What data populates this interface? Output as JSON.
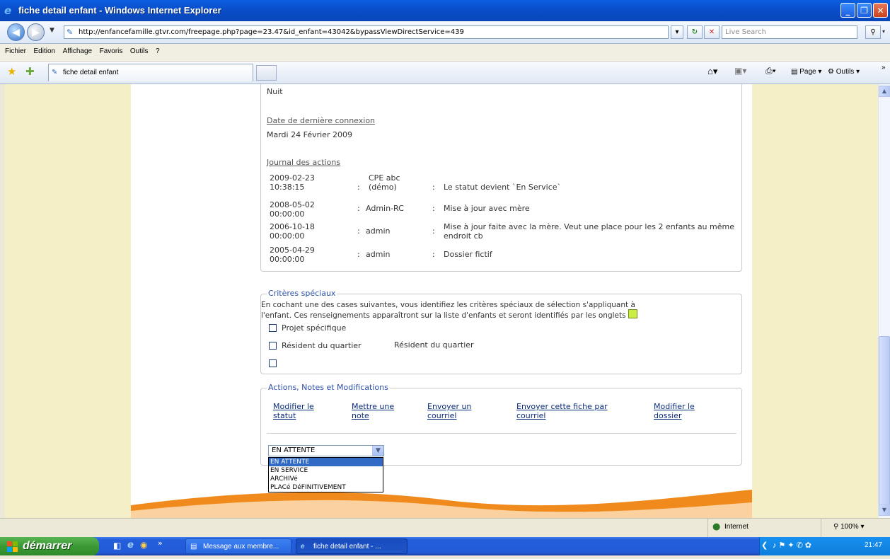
{
  "window": {
    "title": "fiche detail enfant - Windows Internet Explorer",
    "min_glyph": "_",
    "max_glyph": "❐",
    "close_glyph": "✕"
  },
  "address": {
    "url": "http://enfancefamille.gtvr.com/freepage.php?page=23.47&id_enfant=43042&bypassViewDirectService=439",
    "search_placeholder": "Live Search"
  },
  "menu": [
    "Fichier",
    "Edition",
    "Affichage",
    "Favoris",
    "Outils",
    "?"
  ],
  "tab": {
    "title": "fiche detail enfant"
  },
  "commands": {
    "page": "Page",
    "tools": "Outils"
  },
  "content": {
    "top_value": "Nuit",
    "last_login_label": "Date de dernière connexion",
    "last_login_value": "Mardi 24 Février 2009",
    "journal_label": "Journal des actions",
    "journal": [
      {
        "date": "2009-02-23 10:38:15",
        "user": "CPE abc (démo)",
        "action": "Le statut devient `En Service`"
      },
      {
        "date": "2008-05-02 00:00:00",
        "user": "Admin-RC",
        "action": "Mise à jour avec mère"
      },
      {
        "date": "2006-10-18 00:00:00",
        "user": "admin",
        "action": "Mise à jour faite avec la mère. Veut une place pour les 2 enfants au même endroit cb"
      },
      {
        "date": "2005-04-29 00:00:00",
        "user": "admin",
        "action": "Dossier fictif"
      }
    ],
    "criteria": {
      "legend": "Critères spéciaux",
      "description_line1": "En cochant une des cases suivantes, vous identifiez les critères spéciaux de sélection s'appliquant à",
      "description_line2": "l'enfant. Ces renseignements apparaîtront sur la liste d'enfants et seront identifiés par les onglets",
      "tag_color": "#ccee44",
      "items": [
        {
          "label": "Projet spécifique",
          "note": ""
        },
        {
          "label": "Résident du quartier",
          "note": "Résident du quartier"
        },
        {
          "label": "",
          "note": ""
        }
      ]
    },
    "actions": {
      "legend": "Actions, Notes et Modifications",
      "links": [
        {
          "line1": "Modifier le",
          "line2": "statut"
        },
        {
          "line1": "Mettre une",
          "line2": "note"
        },
        {
          "line1": "Envoyer un",
          "line2": "courriel"
        },
        {
          "line1": "Envoyer cette fiche par",
          "line2": "courriel"
        },
        {
          "line1": "Modifier le",
          "line2": "dossier"
        }
      ],
      "status_select": {
        "selected": "EN ATTENTE",
        "options": [
          "EN ATTENTE",
          "EN SERVICE",
          "ARCHIVé",
          "PLACé DéFINITIVEMENT"
        ]
      }
    }
  },
  "status": {
    "zone": "Internet",
    "zoom": "100%"
  },
  "taskbar": {
    "start": "démarrer",
    "tasks": [
      "Message aux membre...",
      "fiche detail enfant - ..."
    ],
    "clock": "21:47"
  },
  "colors": {
    "page_bg": "#f5efc8",
    "legend": "#2a4fa8",
    "link": "#0b2c7a",
    "swoosh": "#f08a1c"
  }
}
